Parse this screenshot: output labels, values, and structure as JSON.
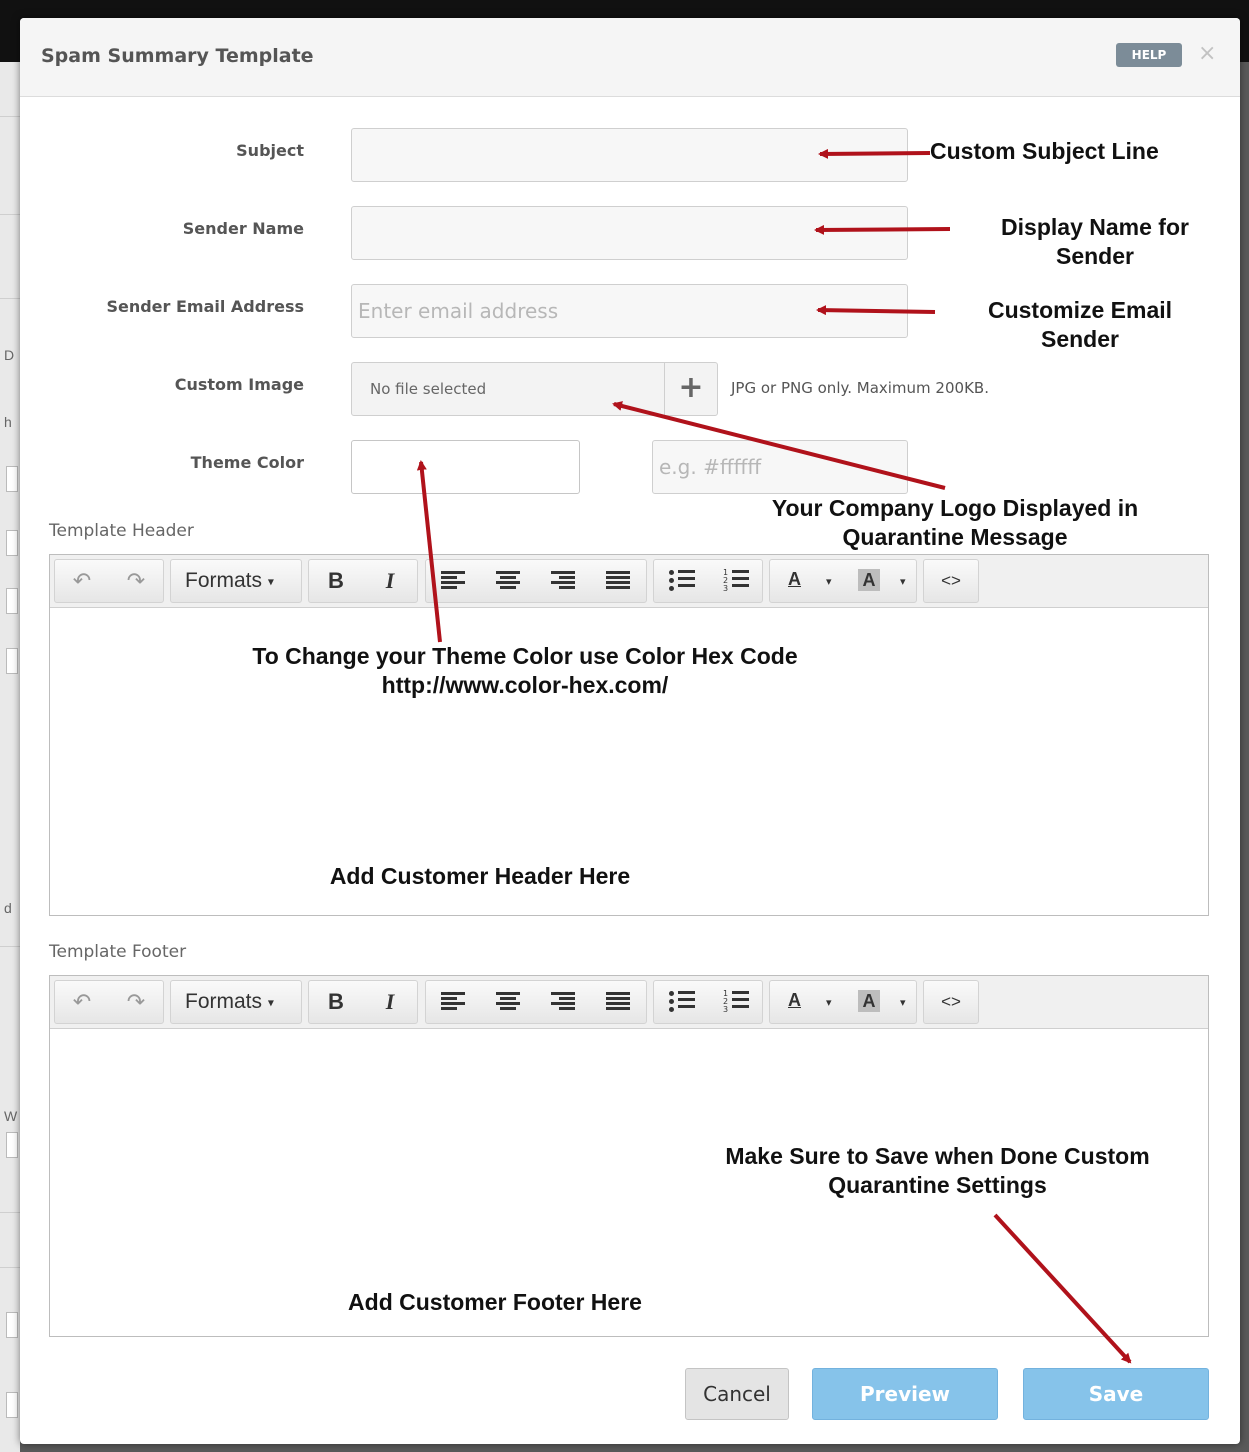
{
  "dialog": {
    "title": "Spam Summary Template",
    "help_label": "HELP",
    "close_glyph": "×"
  },
  "form": {
    "subject_label": "Subject",
    "subject_value": "",
    "sender_name_label": "Sender Name",
    "sender_name_value": "",
    "sender_email_label": "Sender Email Address",
    "sender_email_placeholder": "Enter email address",
    "custom_image_label": "Custom Image",
    "file_status": "No file selected",
    "add_glyph": "+",
    "image_hint": "JPG or PNG only. Maximum 200KB.",
    "theme_color_label": "Theme Color",
    "theme_color_placeholder": "e.g. #ffffff"
  },
  "editors": {
    "header_label": "Template Header",
    "footer_label": "Template Footer",
    "toolbar": {
      "undo_glyph": "↶",
      "redo_glyph": "↷",
      "formats_label": "Formats",
      "caret": "▾",
      "bold_glyph": "B",
      "italic_glyph": "I",
      "text_color_glyph": "A",
      "bg_color_glyph": "A",
      "code_glyph": "<>"
    }
  },
  "annotations": {
    "subject": "Custom Subject Line",
    "sender_name": "Display Name for Sender",
    "sender_email": "Customize Email Sender",
    "logo": "Your Company Logo Displayed in Quarantine Message",
    "theme_color": "To Change your Theme Color use Color Hex Code http://www.color-hex.com/",
    "header": "Add Customer Header Here",
    "save_reminder": "Make Sure to Save when Done Custom Quarantine Settings",
    "footer": "Add Customer Footer Here"
  },
  "buttons": {
    "cancel": "Cancel",
    "preview": "Preview",
    "save": "Save"
  },
  "colors": {
    "arrow": "#b0121b",
    "primary_button": "#86c3ea",
    "help_badge": "#7c8c98"
  },
  "icons": [
    "undo-icon",
    "redo-icon",
    "bold-icon",
    "italic-icon",
    "align-left-icon",
    "align-center-icon",
    "align-right-icon",
    "align-justify-icon",
    "bullet-list-icon",
    "numbered-list-icon",
    "text-color-icon",
    "background-color-icon",
    "source-code-icon",
    "plus-icon",
    "close-icon"
  ]
}
